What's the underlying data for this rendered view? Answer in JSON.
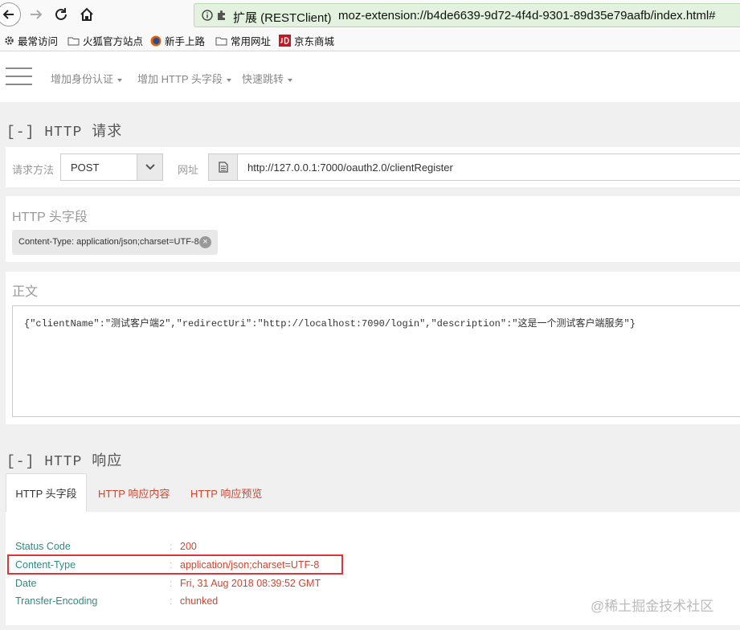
{
  "browser": {
    "extension_label": "扩展 (RESTClient)",
    "url": "moz-extension://b4de6639-9d72-4f4d-9301-89d35e79aafb/index.html#",
    "bookmarks": [
      "最常访问",
      "火狐官方站点",
      "新手上路",
      "常用网址",
      "京东商城"
    ]
  },
  "nav": {
    "items": [
      "增加身份认证",
      "增加 HTTP 头字段",
      "快速跳转"
    ]
  },
  "request": {
    "title": "[-] HTTP 请求",
    "method_label": "请求方法",
    "method": "POST",
    "url_label": "网址",
    "url": "http://127.0.0.1:7000/oauth2.0/clientRegister",
    "headers_title": "HTTP 头字段",
    "header_tag": "Content-Type: application/json;charset=UTF-8",
    "body_title": "正文",
    "body": "{\"clientName\":\"测试客户端2\",\"redirectUri\":\"http://localhost:7090/login\",\"description\":\"这是一个测试客户端服务\"}"
  },
  "response": {
    "title": "[-] HTTP 响应",
    "tabs": [
      "HTTP 头字段",
      "HTTP 响应内容",
      "HTTP 响应预览"
    ],
    "rows": [
      {
        "key": "Status Code",
        "value": "200"
      },
      {
        "key": "Content-Type",
        "value": "application/json;charset=UTF-8"
      },
      {
        "key": "Date",
        "value": "Fri, 31 Aug 2018 08:39:52 GMT"
      },
      {
        "key": "Transfer-Encoding",
        "value": "chunked"
      }
    ]
  },
  "watermark": "@稀土掘金技术社区",
  "colors": {
    "accent_red": "#d0452f",
    "key_teal": "#2e8b83",
    "url_bar_green": "#e3f2df"
  }
}
